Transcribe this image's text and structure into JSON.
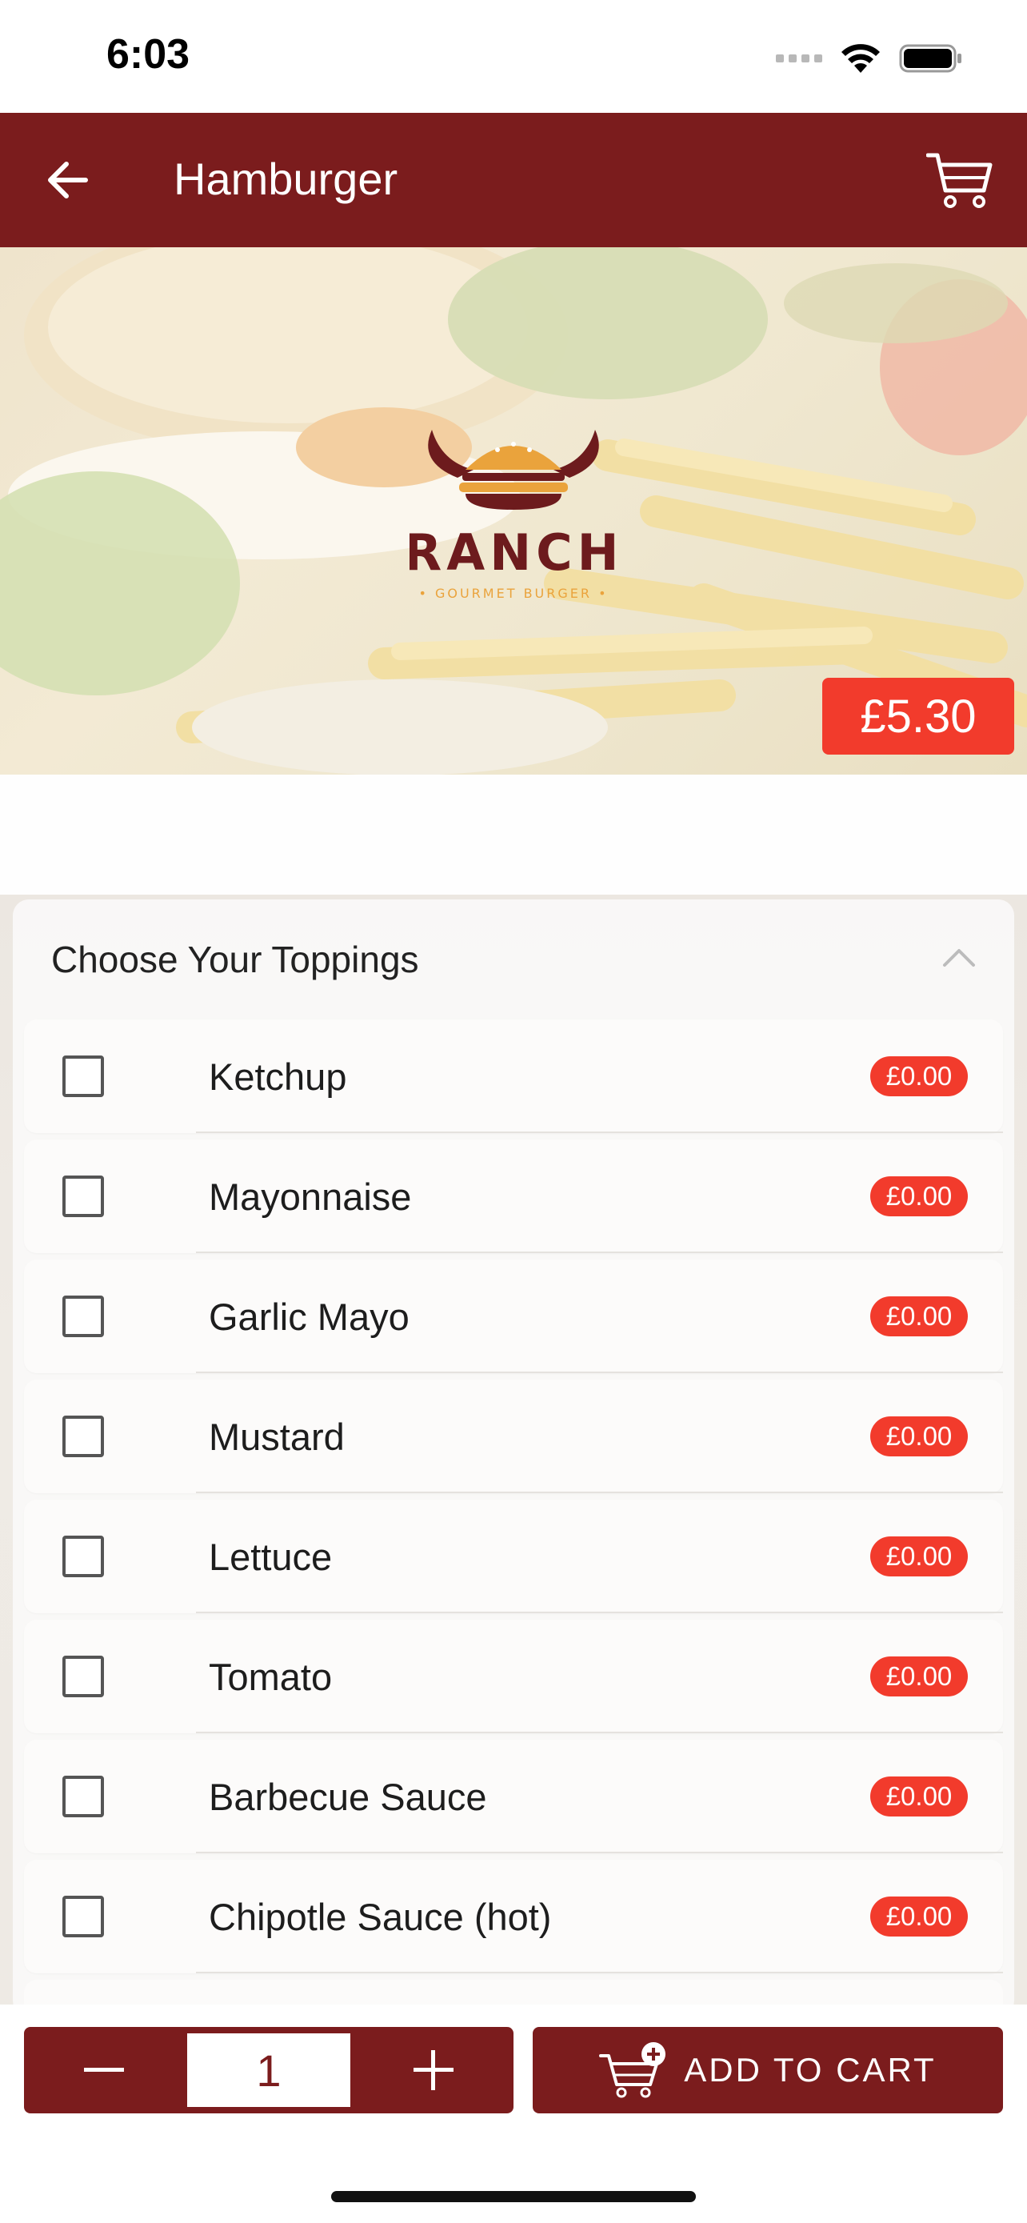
{
  "status_bar": {
    "time": "6:03"
  },
  "nav": {
    "title": "Hamburger"
  },
  "hero": {
    "logo_text": "RANCH",
    "logo_subtext": "GOURMET BURGER",
    "price": "£5.30"
  },
  "toppings": {
    "title": "Choose Your Toppings",
    "items": [
      {
        "label": "Ketchup",
        "price": "£0.00",
        "checked": false
      },
      {
        "label": "Mayonnaise",
        "price": "£0.00",
        "checked": false
      },
      {
        "label": "Garlic Mayo",
        "price": "£0.00",
        "checked": false
      },
      {
        "label": "Mustard",
        "price": "£0.00",
        "checked": false
      },
      {
        "label": "Lettuce",
        "price": "£0.00",
        "checked": false
      },
      {
        "label": "Tomato",
        "price": "£0.00",
        "checked": false
      },
      {
        "label": "Barbecue Sauce",
        "price": "£0.00",
        "checked": false
      },
      {
        "label": "Chipotle Sauce (hot)",
        "price": "£0.00",
        "checked": false
      }
    ]
  },
  "bottom": {
    "quantity": "1",
    "add_to_cart_label": "ADD TO CART"
  },
  "colors": {
    "primary": "#7b1c1d",
    "accent_red": "#f23b2c"
  },
  "icons": {
    "back": "arrow-left-icon",
    "cart": "cart-icon",
    "collapse": "chevron-up-icon",
    "minus": "minus-icon",
    "plus": "plus-icon",
    "add_cart": "cart-plus-icon"
  }
}
